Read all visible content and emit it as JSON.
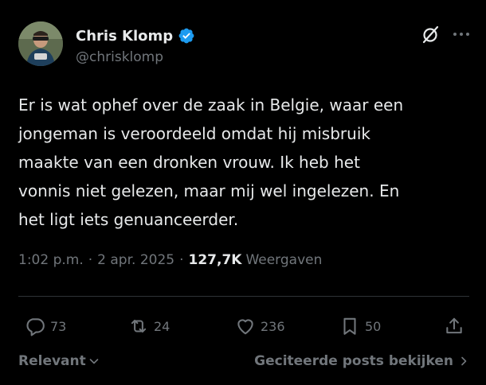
{
  "author": {
    "display_name": "Chris Klomp",
    "handle": "@chrisklomp",
    "verified": true,
    "verified_color": "#1d9bf0"
  },
  "icons": {
    "verified": "verified-badge-icon",
    "grok": "grok-icon",
    "more": "more-horizontal-icon",
    "reply": "reply-icon",
    "repost": "repost-icon",
    "like": "heart-icon",
    "bookmark": "bookmark-icon",
    "share": "share-icon"
  },
  "tweet": {
    "lines": [
      "Er is wat ophef over de zaak in Belgie, waar een",
      "jongeman is veroordeeld omdat hij misbruik",
      "maakte van een dronken vrouw. Ik heb het",
      "vonnis niet gelezen, maar mij wel ingelezen. En",
      "het ligt iets genuanceerder."
    ]
  },
  "meta": {
    "time": "1:02 p.m.",
    "separator": "·",
    "date": "2 apr. 2025",
    "views_count": "127,7K",
    "views_label": "Weergaven"
  },
  "actions": {
    "replies": "73",
    "reposts": "24",
    "likes": "236",
    "bookmarks": "50"
  },
  "footer": {
    "sort_label": "Relevant",
    "quotes_label": "Geciteerde posts bekijken"
  },
  "colors": {
    "background": "#000000",
    "text_primary": "#e7e9ea",
    "text_secondary": "#71767b",
    "divider": "#2f3336"
  }
}
